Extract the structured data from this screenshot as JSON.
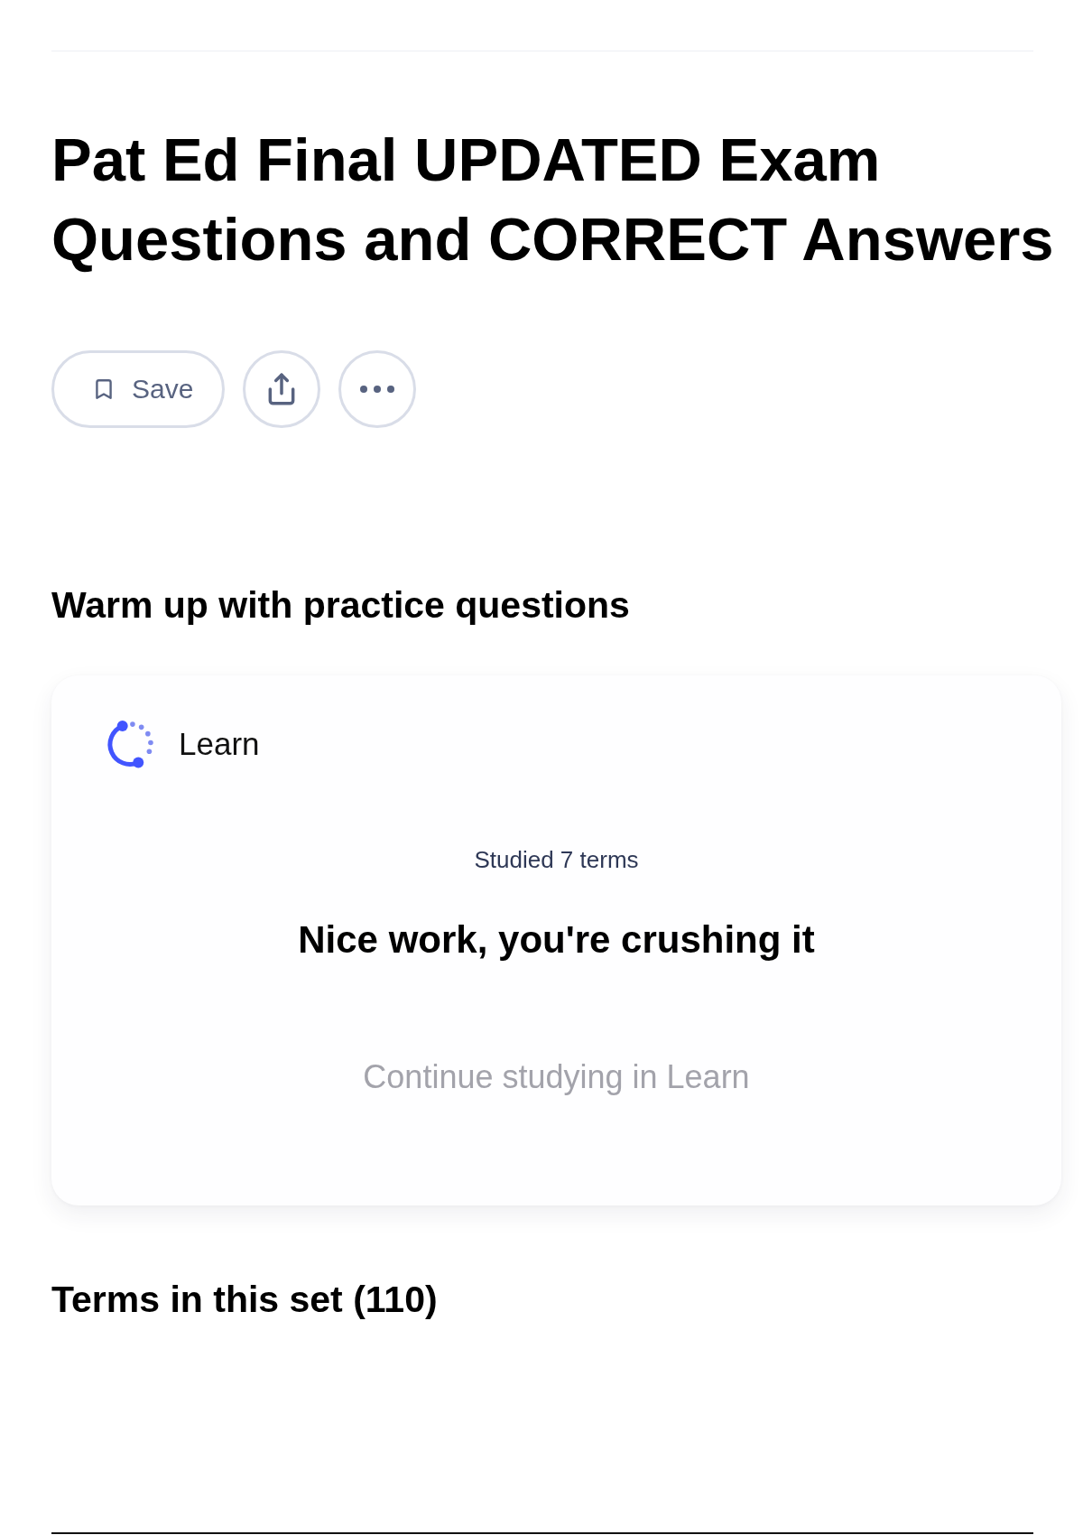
{
  "header": {
    "title": "Pat Ed Final UPDATED Exam Questions and CORRECT Answers"
  },
  "actions": [
    {
      "kind": "save",
      "label": "Save"
    },
    {
      "kind": "share"
    },
    {
      "kind": "more"
    }
  ],
  "practice": {
    "heading": "Warm up with practice questions",
    "card": {
      "mode": "Learn",
      "progress": "Studied 7 terms",
      "message": "Nice work, you're crushing it",
      "button": {
        "label": "Continue studying in Learn",
        "disabled": true
      }
    }
  },
  "terms": {
    "heading": "Terms in this set (110)"
  }
}
